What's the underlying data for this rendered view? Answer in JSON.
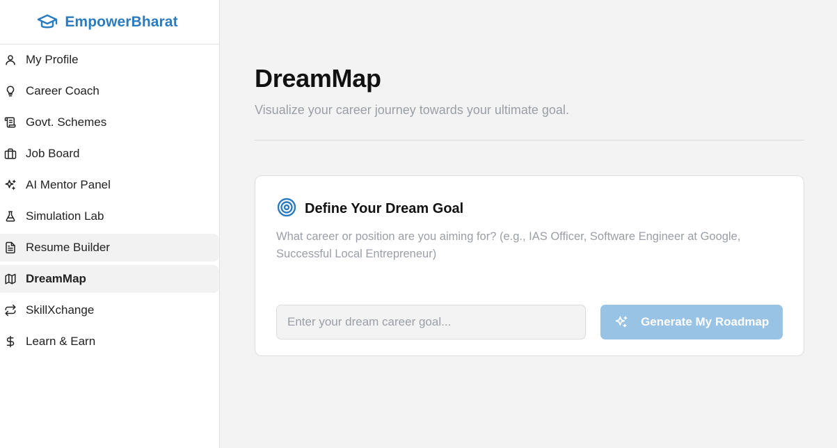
{
  "brand": {
    "name": "EmpowerBharat",
    "icon": "graduation-cap-icon",
    "color": "#2b7bbf"
  },
  "sidebar": {
    "items": [
      {
        "label": "My Profile",
        "icon": "user-icon"
      },
      {
        "label": "Career Coach",
        "icon": "lightbulb-icon"
      },
      {
        "label": "Govt. Schemes",
        "icon": "scroll-icon"
      },
      {
        "label": "Job Board",
        "icon": "briefcase-icon"
      },
      {
        "label": "AI Mentor Panel",
        "icon": "sparkles-icon"
      },
      {
        "label": "Simulation Lab",
        "icon": "flask-icon"
      },
      {
        "label": "Resume Builder",
        "icon": "file-text-icon"
      },
      {
        "label": "DreamMap",
        "icon": "map-icon",
        "active": true
      },
      {
        "label": "SkillXchange",
        "icon": "arrows-exchange-icon"
      },
      {
        "label": "Learn & Earn",
        "icon": "dollar-icon"
      }
    ]
  },
  "main": {
    "title": "DreamMap",
    "subtitle": "Visualize your career journey towards your ultimate goal.",
    "card": {
      "icon": "target-icon",
      "title": "Define Your Dream Goal",
      "description": "What career or position are you aiming for? (e.g., IAS Officer, Software Engineer at Google, Successful Local Entrepreneur)",
      "input_placeholder": "Enter your dream career goal...",
      "input_value": "",
      "button_label": "Generate My Roadmap",
      "button_icon": "sparkles-icon",
      "button_color": "#99c3e5"
    }
  }
}
